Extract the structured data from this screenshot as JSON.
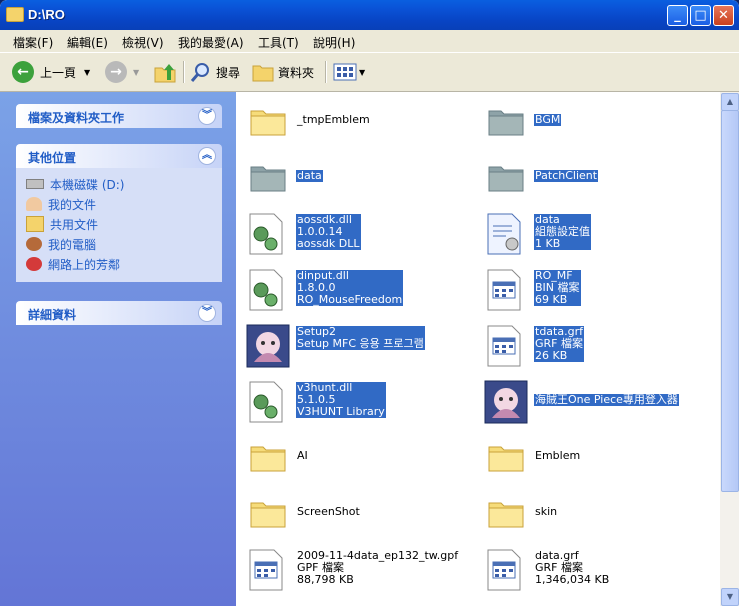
{
  "title": "D:\\RO",
  "menu": [
    "檔案(F)",
    "編輯(E)",
    "檢視(V)",
    "我的最愛(A)",
    "工具(T)",
    "說明(H)"
  ],
  "toolbar": {
    "back": "上一頁",
    "search": "搜尋",
    "folders": "資料夾"
  },
  "left_panel": {
    "tasks_title": "檔案及資料夾工作",
    "other_title": "其他位置",
    "other_links": [
      "本機磁碟 (D:)",
      "我的文件",
      "共用文件",
      "我的電腦",
      "網路上的芳鄰"
    ],
    "details_title": "詳細資料"
  },
  "files": [
    {
      "lines": [
        "_tmpEmblem"
      ],
      "icon": "folder-icon",
      "selected": false
    },
    {
      "lines": [
        "BGM"
      ],
      "icon": "folder-icon",
      "selected": true
    },
    {
      "lines": [
        "data"
      ],
      "icon": "folder-icon",
      "selected": true
    },
    {
      "lines": [
        "PatchClient"
      ],
      "icon": "folder-icon",
      "selected": true
    },
    {
      "lines": [
        "aossdk.dll",
        "1.0.0.14",
        "aossdk DLL"
      ],
      "icon": "dll-icon",
      "selected": true
    },
    {
      "lines": [
        "data",
        "組態設定值",
        "1 KB"
      ],
      "icon": "config-icon",
      "selected": true
    },
    {
      "lines": [
        "dinput.dll",
        "1.8.0.0",
        "RO_MouseFreedom"
      ],
      "icon": "dll-icon",
      "selected": true
    },
    {
      "lines": [
        "RO_MF",
        "BIN 檔案",
        "69 KB"
      ],
      "icon": "generic-file-icon",
      "selected": true
    },
    {
      "lines": [
        "Setup2",
        "Setup MFC 응용 프로그램"
      ],
      "icon": "app-icon",
      "selected": true
    },
    {
      "lines": [
        "tdata.grf",
        "GRF 檔案",
        "26 KB"
      ],
      "icon": "generic-file-icon",
      "selected": true
    },
    {
      "lines": [
        "v3hunt.dll",
        "5.1.0.5",
        "V3HUNT Library"
      ],
      "icon": "dll-icon",
      "selected": true
    },
    {
      "lines": [
        "海賊王One Piece專用登入器"
      ],
      "icon": "app-icon",
      "selected": true
    },
    {
      "lines": [
        "AI"
      ],
      "icon": "folder-icon",
      "selected": false
    },
    {
      "lines": [
        "Emblem"
      ],
      "icon": "folder-icon",
      "selected": false
    },
    {
      "lines": [
        "ScreenShot"
      ],
      "icon": "folder-icon",
      "selected": false
    },
    {
      "lines": [
        "skin"
      ],
      "icon": "folder-icon",
      "selected": false
    },
    {
      "lines": [
        "2009-11-4data_ep132_tw.gpf",
        "GPF 檔案",
        "88,798 KB"
      ],
      "icon": "generic-file-icon",
      "selected": false
    },
    {
      "lines": [
        "data.grf",
        "GRF 檔案",
        "1,346,034 KB"
      ],
      "icon": "generic-file-icon",
      "selected": false
    }
  ]
}
